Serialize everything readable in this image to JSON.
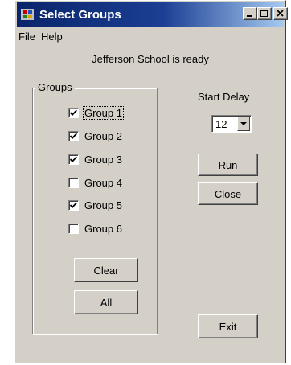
{
  "window": {
    "title": "Select Groups",
    "title_bar_color": "#0a246a"
  },
  "menu": {
    "items": [
      {
        "label": "File"
      },
      {
        "label": "Help"
      }
    ]
  },
  "status": {
    "text": "Jefferson School is ready"
  },
  "groups": {
    "box_label": "Groups",
    "items": [
      {
        "label": "Group 1",
        "checked": true,
        "focused": true
      },
      {
        "label": "Group 2",
        "checked": true,
        "focused": false
      },
      {
        "label": "Group 3",
        "checked": true,
        "focused": false
      },
      {
        "label": "Group 4",
        "checked": false,
        "focused": false
      },
      {
        "label": "Group 5",
        "checked": true,
        "focused": false
      },
      {
        "label": "Group 6",
        "checked": false,
        "focused": false
      }
    ],
    "clear_label": "Clear",
    "all_label": "All"
  },
  "start_delay": {
    "label": "Start Delay",
    "value": "12"
  },
  "buttons": {
    "run_label": "Run",
    "close_label": "Close",
    "exit_label": "Exit"
  },
  "icons": {
    "app": "app-icon",
    "minimize": "minimize-icon",
    "maximize": "maximize-icon",
    "close": "close-icon",
    "dropdown": "chevron-down-icon",
    "check": "checkmark-icon"
  }
}
